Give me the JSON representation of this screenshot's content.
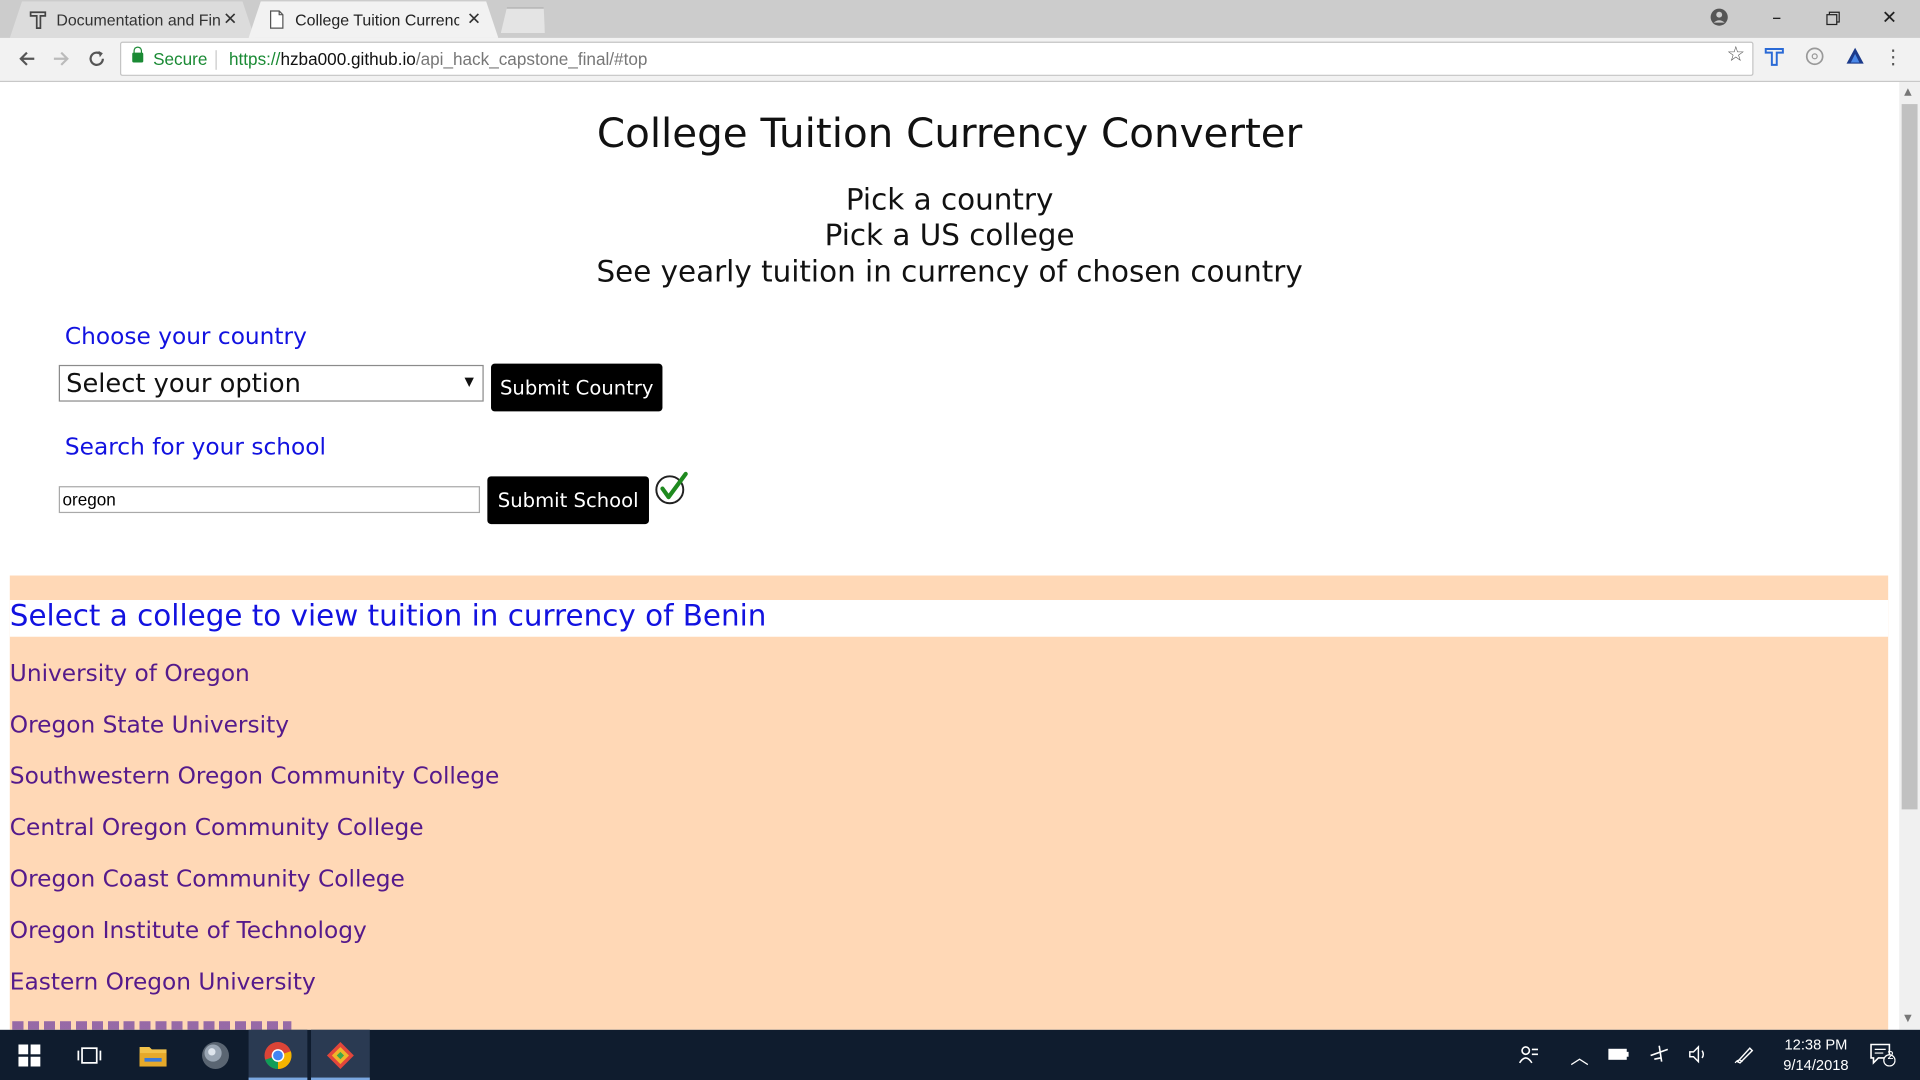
{
  "browser": {
    "tabs": [
      {
        "title": "Documentation and Final"
      },
      {
        "title": "College Tuition Currency"
      }
    ],
    "address": {
      "secure_label": "Secure",
      "scheme": "https://",
      "host": "hzba000.github.io",
      "path": "/api_hack_capstone_final/#top"
    }
  },
  "page": {
    "title": "College Tuition Currency Converter",
    "steps": [
      "Pick a country",
      "Pick a US college",
      "See yearly tuition in currency of chosen country"
    ],
    "country": {
      "label": "Choose your country",
      "select_value": "Select your option",
      "submit_label": "Submit Country"
    },
    "school": {
      "label": "Search for your school",
      "input_value": "oregon",
      "submit_label": "Submit School"
    },
    "results": {
      "title": "Select a college to view tuition in currency of Benin",
      "schools": [
        "University of Oregon",
        "Oregon State University",
        "Southwestern Oregon Community College",
        "Central Oregon Community College",
        "Oregon Coast Community College",
        "Oregon Institute of Technology",
        "Eastern Oregon University"
      ]
    }
  },
  "taskbar": {
    "time": "12:38 PM",
    "date": "9/14/2018",
    "notification_count": "2"
  },
  "colors": {
    "link_blue": "#1212e0",
    "visited_purple": "#551a8b",
    "results_bg": "#ffd8b6",
    "secure_green": "#1a8a34"
  },
  "icons": {
    "tab1": "typora-icon",
    "tab2": "page-icon",
    "check": "green-check-icon"
  }
}
